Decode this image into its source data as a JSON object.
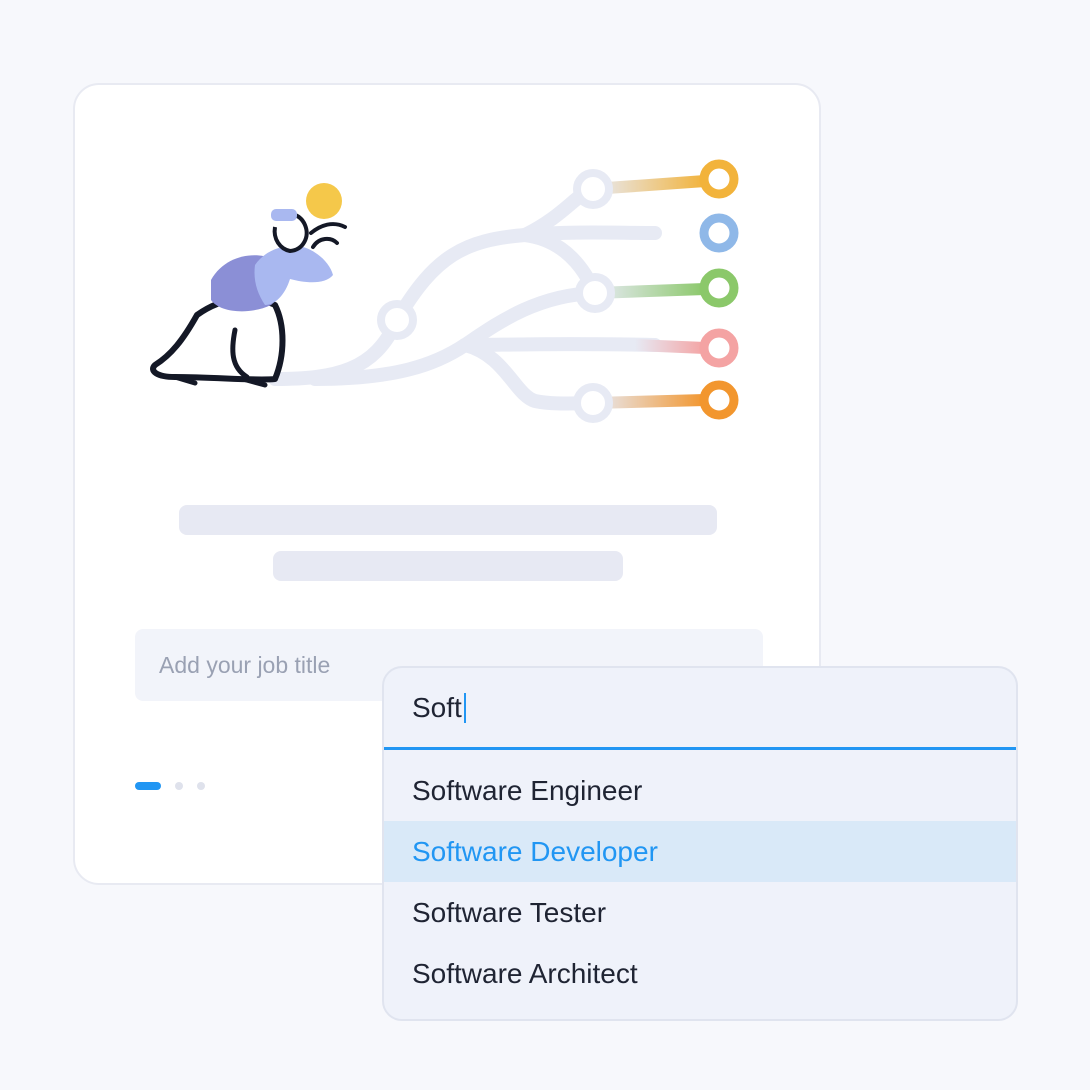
{
  "card": {
    "job_title_placeholder": "Add your job title",
    "pager": {
      "count": 3,
      "active_index": 0
    }
  },
  "dropdown": {
    "typed_value": "Soft",
    "options": [
      {
        "label": "Software Engineer",
        "selected": false
      },
      {
        "label": "Software Developer",
        "selected": true
      },
      {
        "label": "Software Tester",
        "selected": false
      },
      {
        "label": "Software Architect",
        "selected": false
      }
    ]
  },
  "colors": {
    "accent": "#2196f3",
    "node_colors": [
      "#f2b33b",
      "#8fb8e8",
      "#8bc86a",
      "#f4a3a3",
      "#f2962e"
    ]
  },
  "icons": [
    "person-with-telescope-illustration",
    "career-path-tree-illustration"
  ]
}
